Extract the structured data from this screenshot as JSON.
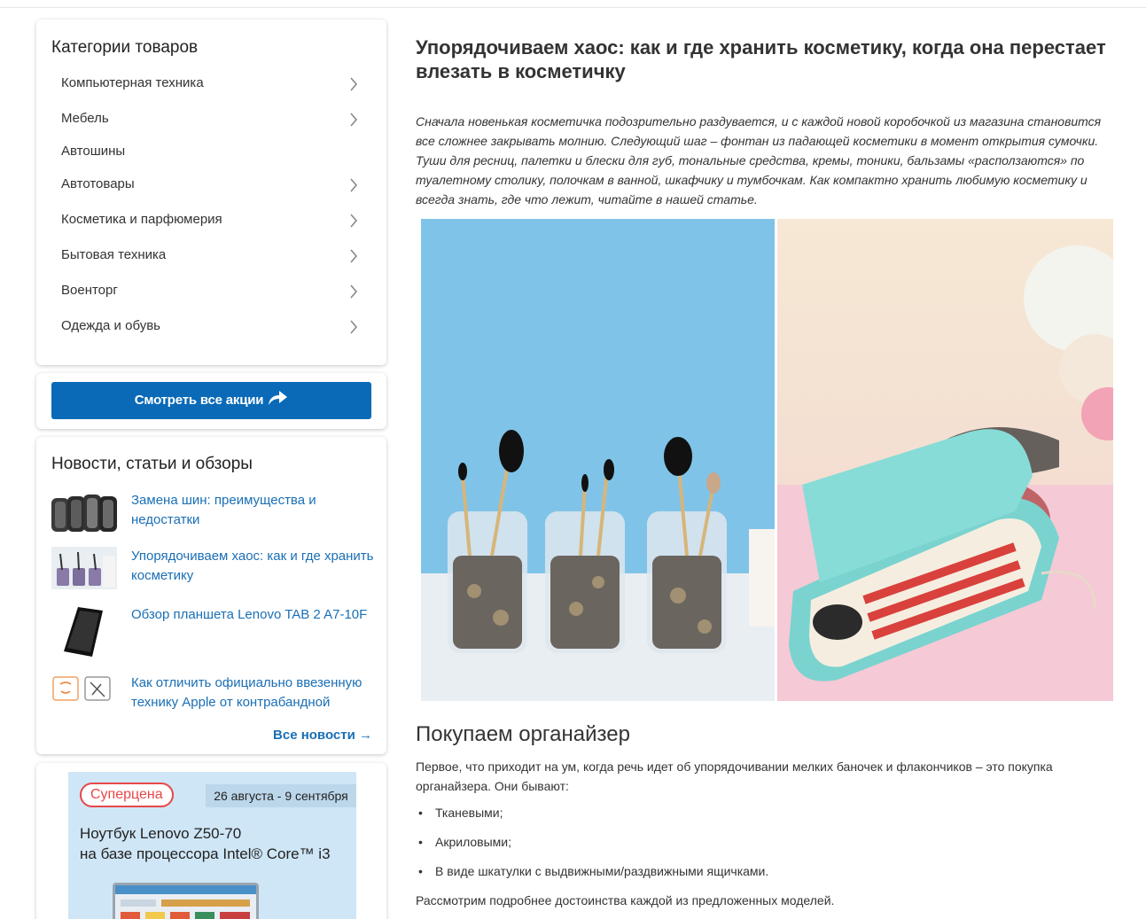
{
  "sidebar": {
    "categories_title": "Категории товаров",
    "categories": [
      {
        "label": "Компьютерная техника",
        "has_arrow": true
      },
      {
        "label": "Мебель",
        "has_arrow": true
      },
      {
        "label": "Автошины",
        "has_arrow": false
      },
      {
        "label": "Автотовары",
        "has_arrow": true
      },
      {
        "label": "Косметика и парфюмерия",
        "has_arrow": true
      },
      {
        "label": "Бытовая техника",
        "has_arrow": true
      },
      {
        "label": "Военторг",
        "has_arrow": true
      },
      {
        "label": "Одежда и обувь",
        "has_arrow": true
      }
    ],
    "cta_label": "Смотреть все акции",
    "news_title": "Новости, статьи и обзоры",
    "news": [
      {
        "title": "Замена шин: преимущества и недостатки",
        "thumb": "tires-thumbnail"
      },
      {
        "title": "Упорядочиваем хаос: как и где хранить косметику",
        "thumb": "cosmetics-thumbnail"
      },
      {
        "title": "Обзор планшета Lenovo TAB 2 A7-10F",
        "thumb": "tablet-thumbnail"
      },
      {
        "title": "Как отличить официально ввезенную технику Apple от контрабандной",
        "thumb": "apple-icons-thumbnail"
      }
    ],
    "news_all_label": "Все новости →",
    "promo": {
      "badge": "Суперцена",
      "dates": "26 августа - 9 сентября",
      "line1": "Ноутбук Lenovo Z50-70",
      "line2": "на базе процессора Intel® Core™ i3"
    }
  },
  "article": {
    "title": "Упорядочиваем хаос: как и где хранить косметику, когда она перестает влезать в косметичку",
    "lead": "Сначала новенькая косметичка подозрительно раздувается, и с каждой новой коробочкой из магазина становится все сложнее закрывать молнию. Следующий шаг – фонтан из падающей косметики в момент открытия сумочки. Туши для ресниц, палетки и блески для губ, тональные средства, кремы, тоники, бальзамы «расползаются» по туалетному столику, полочкам в ванной, шкафчику и тумбочкам. Как компактно хранить любимую косметику и всегда знать, где что лежит, читайте в нашей статье.",
    "section_title": "Покупаем органайзер",
    "section_intro": "Первое, что приходит на ум, когда речь идет об упорядочивании мелких баночек и флакончиков – это покупка органайзера. Они бывают:",
    "list": [
      "Тканевыми;",
      "Акриловыми;",
      "В виде шкатулки с выдвижными/раздвижными ящичками."
    ],
    "section_outro": "Рассмотрим подробнее достоинства каждой из предложенных моделей."
  },
  "colors": {
    "link": "#1a6fb5",
    "button": "#0a6ab7",
    "promo_badge": "#e8474a"
  }
}
